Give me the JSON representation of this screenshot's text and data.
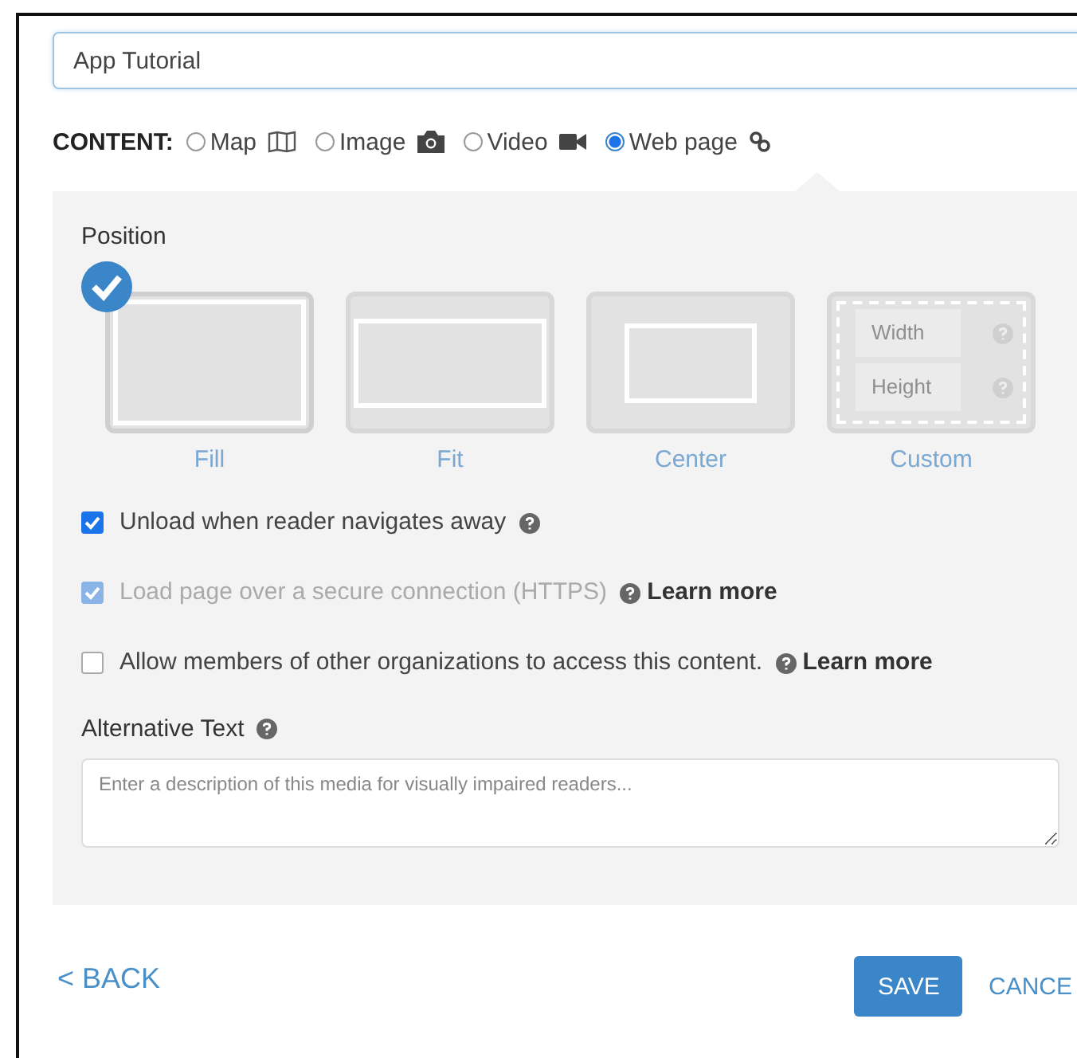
{
  "title_field": {
    "value": "App Tutorial"
  },
  "content": {
    "label": "CONTENT:",
    "options": [
      {
        "label": "Map",
        "kind": "map",
        "selected": false
      },
      {
        "label": "Image",
        "kind": "image",
        "selected": false
      },
      {
        "label": "Video",
        "kind": "video",
        "selected": false
      },
      {
        "label": "Web page",
        "kind": "webpage",
        "selected": true
      }
    ]
  },
  "position": {
    "label": "Position",
    "tiles": [
      {
        "label": "Fill",
        "kind": "fill",
        "selected": true
      },
      {
        "label": "Fit",
        "kind": "fit",
        "selected": false
      },
      {
        "label": "Center",
        "kind": "center",
        "selected": false
      },
      {
        "label": "Custom",
        "kind": "custom",
        "selected": false,
        "width_placeholder": "Width",
        "height_placeholder": "Height"
      }
    ]
  },
  "options": [
    {
      "text": "Unload when reader navigates away",
      "checked": true,
      "disabled": false
    },
    {
      "text": "Load page over a secure connection (HTTPS)",
      "checked": true,
      "disabled": true,
      "link": "Learn more"
    },
    {
      "text": "Allow members of other organizations to access this content.",
      "checked": false,
      "disabled": false,
      "link": "Learn more"
    }
  ],
  "alt_text": {
    "label": "Alternative Text",
    "placeholder": "Enter a description of this media for visually impaired readers..."
  },
  "footer": {
    "back": "< BACK",
    "save": "SAVE",
    "cancel": "CANCE"
  }
}
